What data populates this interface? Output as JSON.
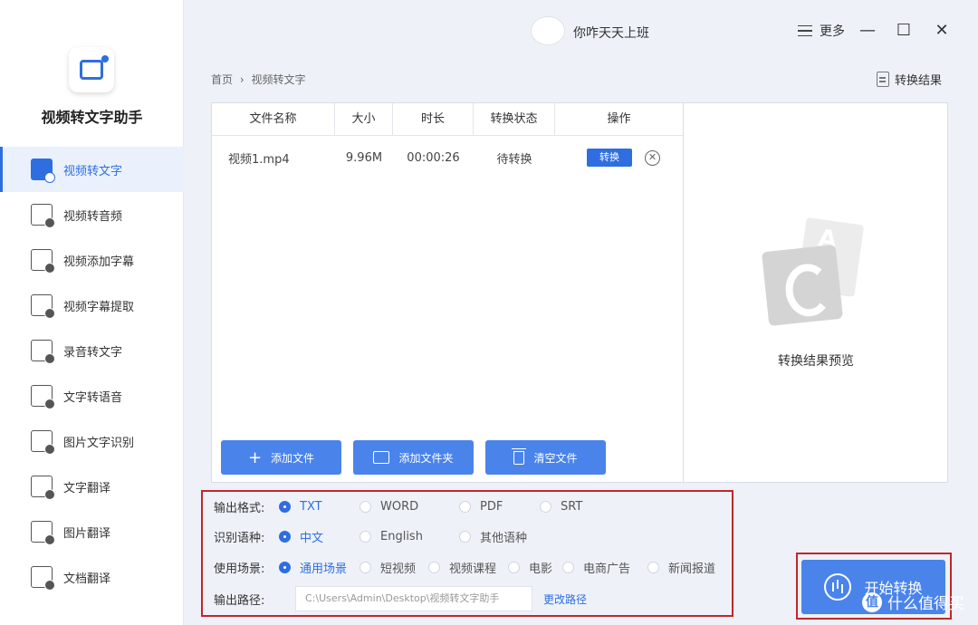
{
  "app": {
    "name": "视频转文字助手"
  },
  "header": {
    "user_name": "你咋天天上班",
    "menu_label": "更多",
    "minimize": "—",
    "maximize": "☐",
    "close": "✕"
  },
  "sidebar": {
    "items": [
      {
        "label": "视频转文字",
        "icon": "video-to-text-icon",
        "active": true
      },
      {
        "label": "视频转音频",
        "icon": "video-to-audio-icon",
        "active": false
      },
      {
        "label": "视频添加字幕",
        "icon": "add-subtitle-icon",
        "active": false
      },
      {
        "label": "视频字幕提取",
        "icon": "subtitle-extract-icon",
        "active": false
      },
      {
        "label": "录音转文字",
        "icon": "recording-icon",
        "active": false
      },
      {
        "label": "文字转语音",
        "icon": "text-to-speech-icon",
        "active": false
      },
      {
        "label": "图片文字识别",
        "icon": "image-ocr-icon",
        "active": false
      },
      {
        "label": "文字翻译",
        "icon": "text-translate-icon",
        "active": false
      },
      {
        "label": "图片翻译",
        "icon": "image-translate-icon",
        "active": false
      },
      {
        "label": "文档翻译",
        "icon": "doc-translate-icon",
        "active": false
      }
    ]
  },
  "breadcrumb": {
    "home": "首页",
    "separator": "›",
    "current": "视频转文字"
  },
  "result_link": "转换结果",
  "table": {
    "columns": [
      "文件名称",
      "大小",
      "时长",
      "转换状态",
      "操作"
    ],
    "rows": [
      {
        "name": "视频1.mp4",
        "size": "9.96M",
        "duration": "00:00:26",
        "status": "待转换",
        "action": "转换"
      }
    ]
  },
  "buttons": {
    "add_file": "添加文件",
    "add_folder": "添加文件夹",
    "clear_files": "清空文件"
  },
  "preview": {
    "label": "转换结果预览"
  },
  "settings": {
    "format_label": "输出格式:",
    "formats": [
      "TXT",
      "WORD",
      "PDF",
      "SRT"
    ],
    "language_label": "识别语种:",
    "languages": [
      "中文",
      "English",
      "其他语种"
    ],
    "scene_label": "使用场景:",
    "scenes": [
      "通用场景",
      "短视频",
      "视频课程",
      "电影",
      "电商广告",
      "新闻报道"
    ],
    "path_label": "输出路径:",
    "path_value": "C:\\Users\\Admin\\Desktop\\视频转文字助手",
    "change_path": "更改路径"
  },
  "start_button": "开始转换",
  "watermark": {
    "badge": "值",
    "text": "什么值得买"
  },
  "colors": {
    "accent": "#2f6ee0",
    "button": "#4a84ea",
    "highlight_border": "#c1262b"
  }
}
